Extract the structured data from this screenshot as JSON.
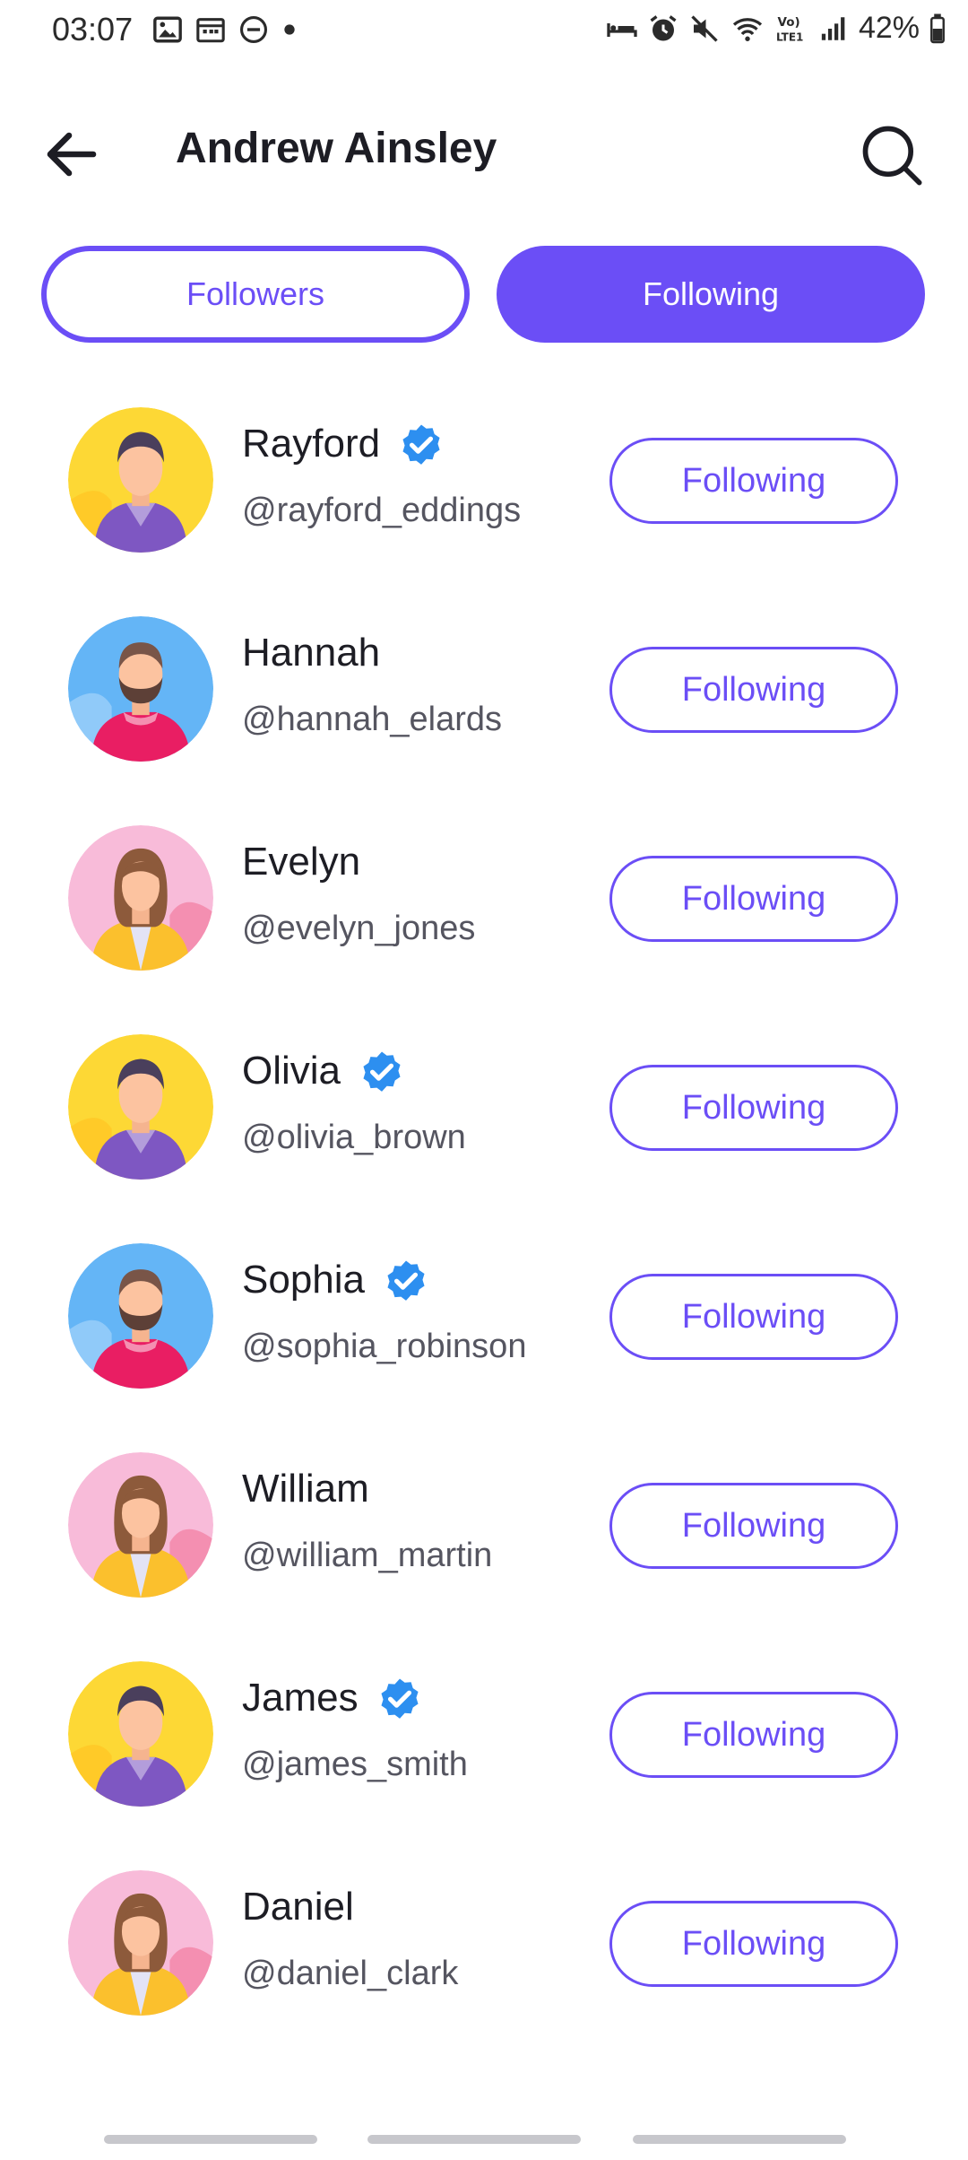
{
  "status_bar": {
    "time": "03:07",
    "battery": "42%",
    "left_icons": [
      "gallery-icon",
      "calendar-icon",
      "dnd-icon",
      "dot-icon"
    ],
    "right_icons": [
      "sleep-icon",
      "alarm-icon",
      "mute-icon",
      "wifi-icon",
      "volte-icon",
      "signal-icon",
      "battery-icon"
    ]
  },
  "header": {
    "title": "Andrew Ainsley"
  },
  "tabs": {
    "followers": "Followers",
    "following": "Following",
    "active": "following"
  },
  "users": [
    {
      "name": "Rayford",
      "handle": "@rayford_eddings",
      "verified": true,
      "avatar": "man-dark-hair",
      "button": "Following"
    },
    {
      "name": "Hannah",
      "handle": "@hannah_elards",
      "verified": false,
      "avatar": "man-beard",
      "button": "Following"
    },
    {
      "name": "Evelyn",
      "handle": "@evelyn_jones",
      "verified": false,
      "avatar": "woman-brown-hair",
      "button": "Following"
    },
    {
      "name": "Olivia",
      "handle": "@olivia_brown",
      "verified": true,
      "avatar": "man-dark-hair",
      "button": "Following"
    },
    {
      "name": "Sophia",
      "handle": "@sophia_robinson",
      "verified": true,
      "avatar": "man-beard",
      "button": "Following"
    },
    {
      "name": "William",
      "handle": "@william_martin",
      "verified": false,
      "avatar": "woman-brown-hair",
      "button": "Following"
    },
    {
      "name": "James",
      "handle": "@james_smith",
      "verified": true,
      "avatar": "man-dark-hair",
      "button": "Following"
    },
    {
      "name": "Daniel",
      "handle": "@daniel_clark",
      "verified": false,
      "avatar": "woman-brown-hair",
      "button": "Following"
    }
  ],
  "colors": {
    "accent": "#6b4ef6",
    "verified": "#2d8ff0",
    "text": "#1d1d24",
    "subtext": "#555560"
  }
}
